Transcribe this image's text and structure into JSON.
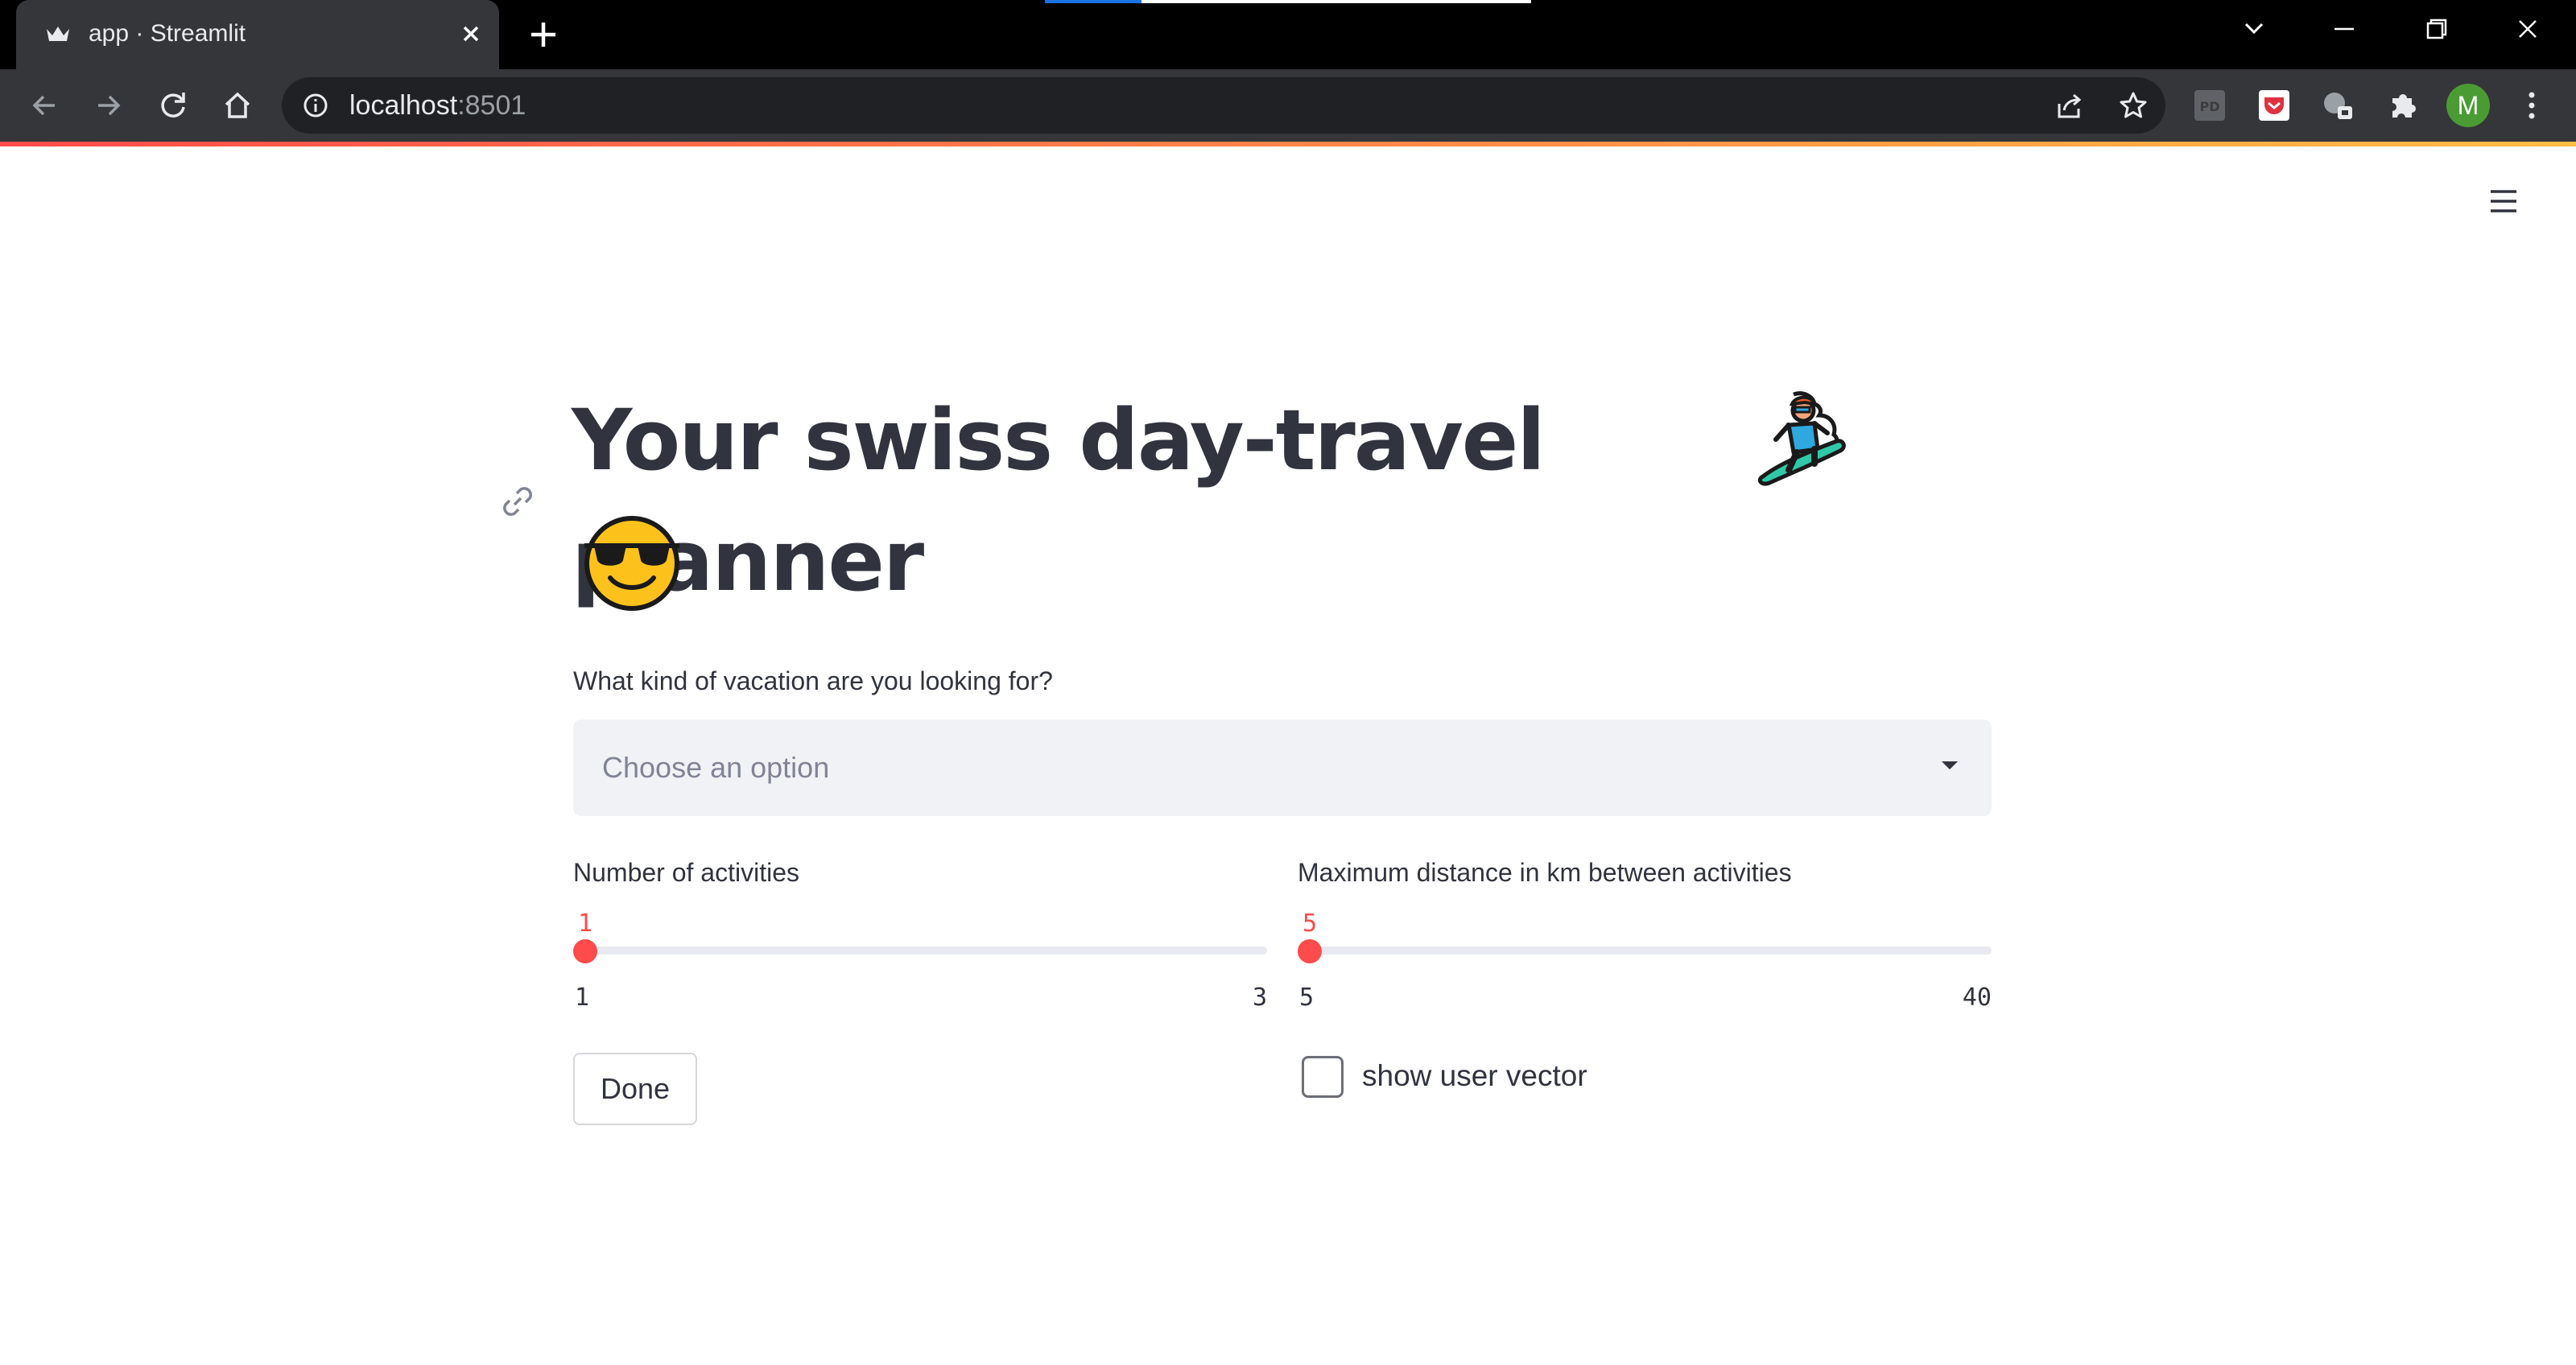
{
  "browser": {
    "tab_title": "app · Streamlit",
    "url_host": "localhost",
    "url_port": ":8501",
    "avatar_initial": "M",
    "favicon_icon": "streamlit-crown-icon"
  },
  "app": {
    "title": "Your swiss day-travel planner",
    "title_emojis": [
      "snowboarder-emoji",
      "smiling-face-with-sunglasses-emoji"
    ],
    "vacation_label": "What kind of vacation are you looking for?",
    "vacation_placeholder": "Choose an option",
    "activities_slider": {
      "label": "Number of activities",
      "value": "1",
      "min": "1",
      "max": "3",
      "fraction": 0.0
    },
    "distance_slider": {
      "label": "Maximum distance in km between activities",
      "value": "5",
      "min": "5",
      "max": "40",
      "fraction": 0.0
    },
    "done_label": "Done",
    "show_vector_label": "show user vector",
    "show_vector_checked": false
  },
  "colors": {
    "accent": "#ff4b4b",
    "text": "#31333f",
    "select_bg": "#f0f2f6"
  }
}
